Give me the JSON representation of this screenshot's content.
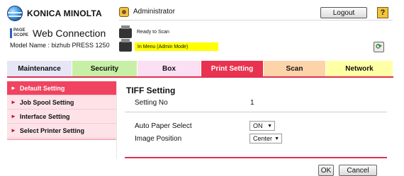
{
  "header": {
    "brand": "KONICA MINOLTA",
    "pages_logo_line1": "PAGE",
    "pages_logo_line2": "SCOPE",
    "product": "Web Connection",
    "model": "Model Name : bizhub PRESS 1250",
    "user": "Administrator",
    "logout_label": "Logout",
    "help_label": "?",
    "status_ready": "Ready to Scan",
    "status_mode": "In Menu (Admin Mode)",
    "refresh_label": "⟳"
  },
  "tabs": [
    {
      "label": "Maintenance",
      "color": "#e6e6f7"
    },
    {
      "label": "Security",
      "color": "#c7f0a6"
    },
    {
      "label": "Box",
      "color": "#fbdff2"
    },
    {
      "label": "Print Setting",
      "color": "#e8324f",
      "active": true
    },
    {
      "label": "Scan",
      "color": "#fdd3a9"
    },
    {
      "label": "Network",
      "color": "#ffffa6"
    }
  ],
  "menu": [
    {
      "label": "Default Setting",
      "active": true
    },
    {
      "label": "Job Spool Setting"
    },
    {
      "label": "Interface Setting"
    },
    {
      "label": "Select Printer Setting"
    }
  ],
  "content": {
    "title": "TIFF Setting",
    "setting_no_label": "Setting No",
    "setting_no_value": "1",
    "auto_paper_label": "Auto Paper Select",
    "auto_paper_value": "ON",
    "image_position_label": "Image Position",
    "image_position_value": "Center"
  },
  "buttons": {
    "ok": "OK",
    "cancel": "Cancel"
  }
}
